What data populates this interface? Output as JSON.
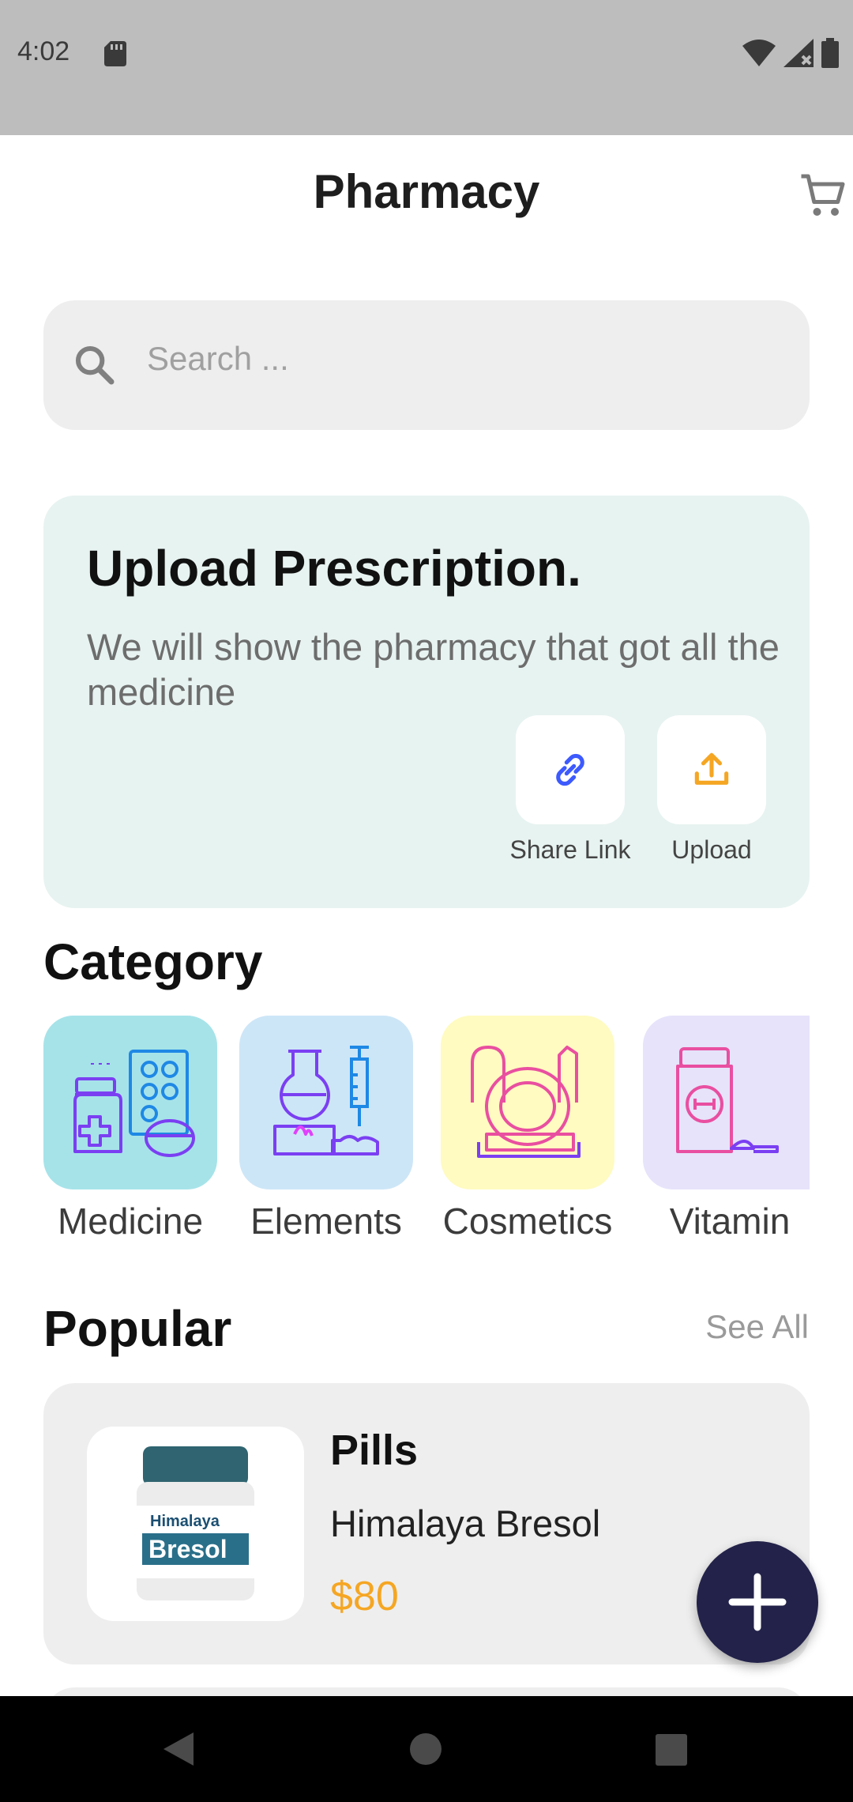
{
  "status_bar": {
    "time": "4:02"
  },
  "app_bar": {
    "title": "Pharmacy"
  },
  "search": {
    "placeholder": "Search ..."
  },
  "upload_card": {
    "title": "Upload Prescription.",
    "subtitle": "We will show the pharmacy that got all the medicine",
    "actions": [
      {
        "label": "Share Link",
        "icon": "link-icon"
      },
      {
        "label": "Upload",
        "icon": "upload-icon"
      }
    ]
  },
  "category": {
    "title": "Category",
    "items": [
      {
        "label": "Medicine",
        "color": "#a6e3e9"
      },
      {
        "label": "Elements",
        "color": "#cde6f7"
      },
      {
        "label": "Cosmetics",
        "color": "#fffbc1"
      },
      {
        "label": "Vitamin",
        "color": "#e6e3fb"
      }
    ]
  },
  "popular": {
    "title": "Popular",
    "see_all": "See All",
    "products": [
      {
        "category": "Pills",
        "name": "Himalaya Bresol",
        "price": "$80",
        "brand": "Himalaya",
        "product_label": "Bresol"
      }
    ]
  },
  "colors": {
    "accent": "#f5a623",
    "fab": "#22224a",
    "link_blue": "#3d5afe",
    "upload_orange": "#f5a623"
  }
}
